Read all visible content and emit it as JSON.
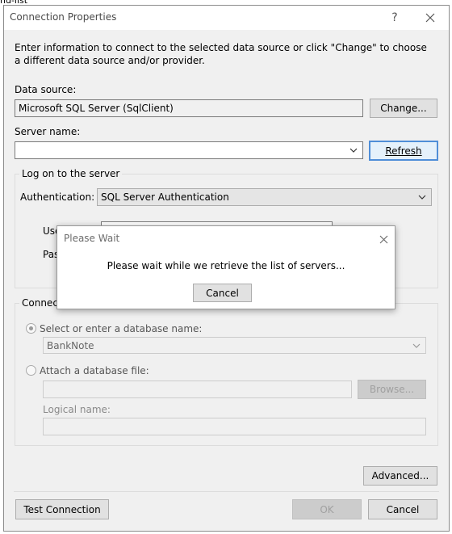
{
  "background_text": "nd-list",
  "window": {
    "title": "Connection Properties",
    "help_button": "?",
    "close_button": "✕"
  },
  "description": "Enter information to connect to the selected data source or click \"Change\" to choose a different data source and/or provider.",
  "data_source": {
    "label": "Data source:",
    "value": "Microsoft SQL Server (SqlClient)",
    "change_button": "Change..."
  },
  "server_name": {
    "label": "Server name:",
    "value": "",
    "refresh_button": "Refresh"
  },
  "logon": {
    "group_title": "Log on to the server",
    "auth_label": "Authentication:",
    "auth_value": "SQL Server Authentication",
    "user_label_partial": "Use",
    "user_value_partial": "Pas",
    "password_label_partial": "Pas"
  },
  "connect": {
    "group_title_partial": "Connect",
    "select_db_label": "Select or enter a database name:",
    "db_value": "BankNote",
    "attach_label": "Attach a database file:",
    "attach_value": "",
    "browse_button": "Browse...",
    "logical_label": "Logical name:",
    "logical_value": ""
  },
  "advanced_button": "Advanced...",
  "test_button": "Test Connection",
  "ok_button": "OK",
  "cancel_button": "Cancel",
  "modal": {
    "title": "Please Wait",
    "close_button": "✕",
    "message": "Please wait while we retrieve the list of servers...",
    "cancel_button": "Cancel"
  },
  "colors": {
    "focus_border": "#4f8ed8",
    "window_bg": "#f0f0f0"
  }
}
